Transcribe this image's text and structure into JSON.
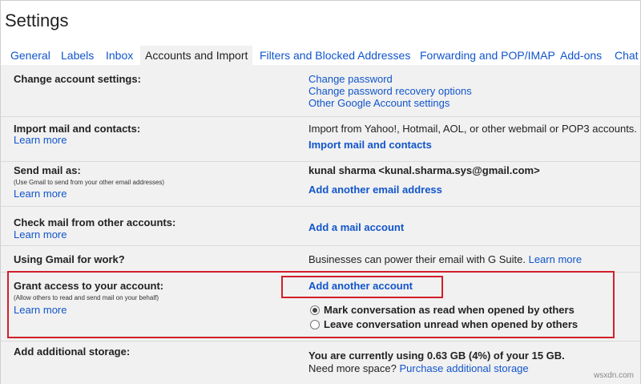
{
  "page": {
    "title": "Settings"
  },
  "tabs": [
    {
      "label": "General"
    },
    {
      "label": "Labels"
    },
    {
      "label": "Inbox"
    },
    {
      "label": "Accounts and Import",
      "active": true
    },
    {
      "label": "Filters and Blocked Addresses"
    },
    {
      "label": "Forwarding and POP/IMAP"
    },
    {
      "label": "Add-ons"
    },
    {
      "label": "Chat"
    }
  ],
  "change_account": {
    "label": "Change account settings:",
    "links": [
      "Change password",
      "Change password recovery options",
      "Other Google Account settings"
    ]
  },
  "import_mail": {
    "label": "Import mail and contacts:",
    "learn_more": "Learn more",
    "description": "Import from Yahoo!, Hotmail, AOL, or other webmail or POP3 accounts.",
    "action": "Import mail and contacts"
  },
  "send_mail": {
    "label": "Send mail as:",
    "note": "(Use Gmail to send from your other email addresses)",
    "learn_more": "Learn more",
    "identity": "kunal sharma <kunal.sharma.sys@gmail.com>",
    "action": "Add another email address"
  },
  "check_mail": {
    "label": "Check mail from other accounts:",
    "learn_more": "Learn more",
    "action": "Add a mail account"
  },
  "gmail_work": {
    "label": "Using Gmail for work?",
    "text": "Businesses can power their email with G Suite.",
    "learn_more": "Learn more"
  },
  "grant_access": {
    "label": "Grant access to your account:",
    "note": "(Allow others to read and send mail on your behalf)",
    "learn_more": "Learn more",
    "action": "Add another account",
    "options": [
      {
        "label": "Mark conversation as read when opened by others",
        "checked": true
      },
      {
        "label": "Leave conversation unread when opened by others",
        "checked": false
      }
    ]
  },
  "storage": {
    "label": "Add additional storage:",
    "usage": "You are currently using 0.63 GB (4%) of your 15 GB.",
    "need_more": "Need more space?",
    "purchase": "Purchase additional storage"
  },
  "highlight_color": "#d21f2b",
  "watermark": "wsxdn.com"
}
